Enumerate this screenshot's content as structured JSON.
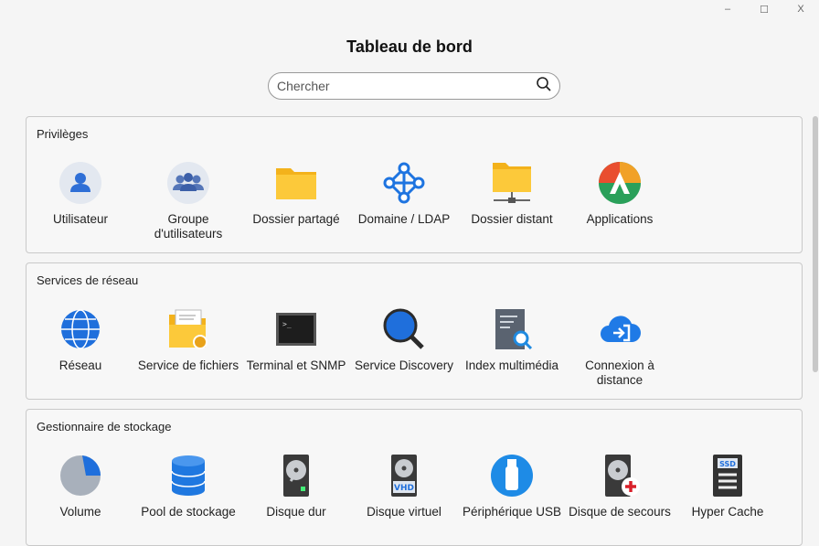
{
  "window": {
    "minimize": "–",
    "maximize": "☐",
    "close": "X"
  },
  "title": "Tableau de bord",
  "search": {
    "placeholder": "Chercher",
    "value": ""
  },
  "sections": [
    {
      "title": "Privilèges",
      "items": [
        {
          "label": "Utilisateur",
          "icon": "user-icon"
        },
        {
          "label": "Groupe d'utilisateurs",
          "icon": "user-group-icon"
        },
        {
          "label": "Dossier partagé",
          "icon": "shared-folder-icon"
        },
        {
          "label": "Domaine / LDAP",
          "icon": "domain-ldap-icon"
        },
        {
          "label": "Dossier distant",
          "icon": "remote-folder-icon"
        },
        {
          "label": "Applications",
          "icon": "applications-icon"
        }
      ]
    },
    {
      "title": "Services de réseau",
      "items": [
        {
          "label": "Réseau",
          "icon": "network-globe-icon"
        },
        {
          "label": "Service de fichiers",
          "icon": "file-service-icon"
        },
        {
          "label": "Terminal et SNMP",
          "icon": "terminal-icon"
        },
        {
          "label": "Service Discovery",
          "icon": "service-discovery-icon"
        },
        {
          "label": "Index multimédia",
          "icon": "multimedia-index-icon"
        },
        {
          "label": "Connexion à distance",
          "icon": "remote-connection-icon"
        }
      ]
    },
    {
      "title": "Gestionnaire de stockage",
      "items": [
        {
          "label": "Volume",
          "icon": "volume-pie-icon"
        },
        {
          "label": "Pool de stockage",
          "icon": "storage-pool-icon"
        },
        {
          "label": "Disque dur",
          "icon": "hard-disk-icon"
        },
        {
          "label": "Disque virtuel",
          "icon": "virtual-disk-icon"
        },
        {
          "label": "Périphérique USB",
          "icon": "usb-icon"
        },
        {
          "label": "Disque de secours",
          "icon": "spare-disk-icon"
        },
        {
          "label": "Hyper Cache",
          "icon": "ssd-cache-icon"
        }
      ]
    }
  ],
  "badges": {
    "vhd": "VHD",
    "ssd": "SSD"
  }
}
